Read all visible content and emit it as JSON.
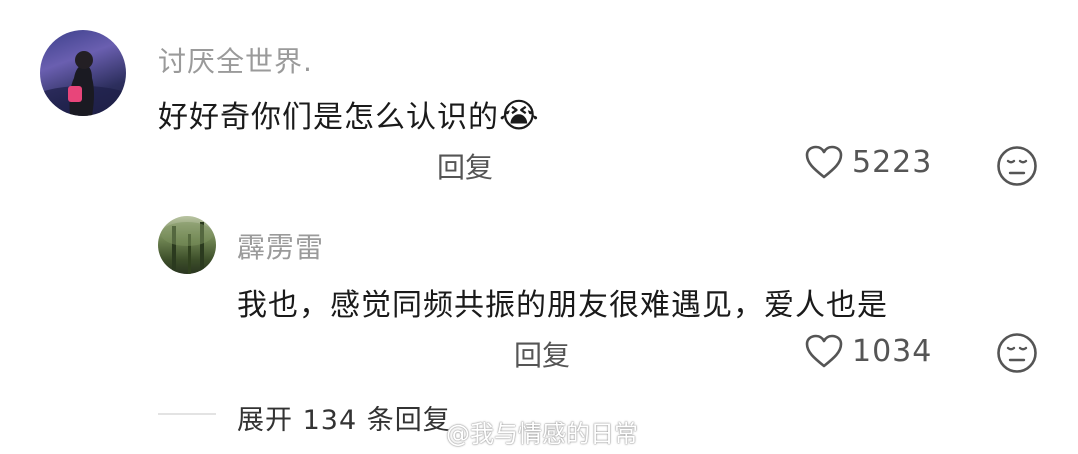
{
  "comments": [
    {
      "username": "讨厌全世界.",
      "text": "好好奇你们是怎么认识的",
      "emoji": "😭",
      "reply_label": "回复",
      "likes": "5223"
    },
    {
      "username": "霹雳雷",
      "text": "我也，感觉同频共振的朋友很难遇见，爱人也是",
      "reply_label": "回复",
      "likes": "1034"
    }
  ],
  "expand_replies": "展开 134 条回复",
  "watermark": "@我与情感的日常"
}
